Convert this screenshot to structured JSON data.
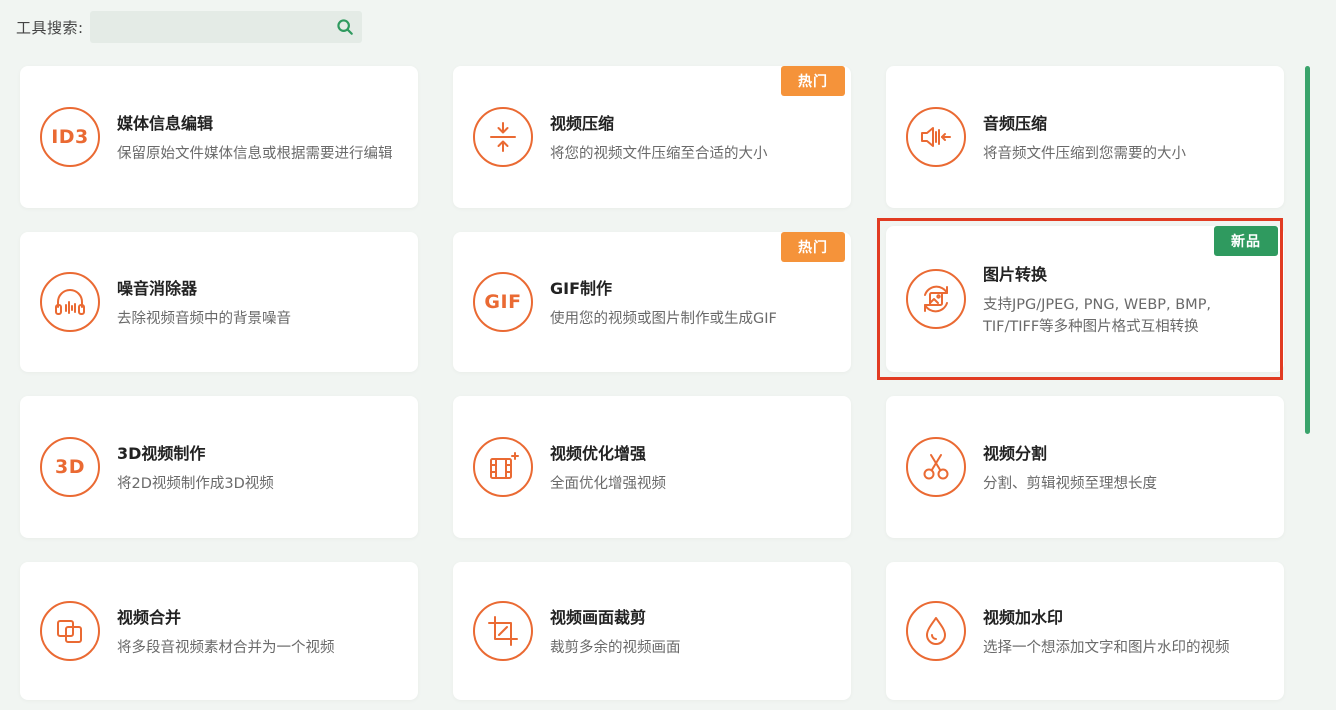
{
  "search": {
    "label": "工具搜索:",
    "value": "",
    "placeholder": ""
  },
  "badges": {
    "hot": "热门",
    "new": "新品"
  },
  "accent": "#ea6a33",
  "tools": [
    {
      "title": "媒体信息编辑",
      "desc": "保留原始文件媒体信息或根据需要进行编辑",
      "icon_text": "ID3",
      "icon": "id3-icon"
    },
    {
      "title": "视频压缩",
      "desc": "将您的视频文件压缩至合适的大小",
      "icon": "compress-icon",
      "badge": "热门"
    },
    {
      "title": "音频压缩",
      "desc": "将音频文件压缩到您需要的大小",
      "icon": "audio-compress-icon"
    },
    {
      "title": "噪音消除器",
      "desc": "去除视频音频中的背景噪音",
      "icon": "headphones-icon"
    },
    {
      "title": "GIF制作",
      "desc": "使用您的视频或图片制作或生成GIF",
      "icon_text": "GIF",
      "icon": "gif-icon",
      "badge": "热门"
    },
    {
      "title": "图片转换",
      "desc": "支持JPG/JPEG, PNG, WEBP, BMP, TIF/TIFF等多种图片格式互相转换",
      "icon": "image-convert-icon",
      "badge": "新品"
    },
    {
      "title": "3D视频制作",
      "desc": "将2D视频制作成3D视频",
      "icon_text": "3D",
      "icon": "3d-icon"
    },
    {
      "title": "视频优化增强",
      "desc": "全面优化增强视频",
      "icon": "film-enhance-icon"
    },
    {
      "title": "视频分割",
      "desc": "分割、剪辑视频至理想长度",
      "icon": "scissors-icon"
    },
    {
      "title": "视频合并",
      "desc": "将多段音视频素材合并为一个视频",
      "icon": "merge-icon"
    },
    {
      "title": "视频画面裁剪",
      "desc": "裁剪多余的视频画面",
      "icon": "crop-icon"
    },
    {
      "title": "视频加水印",
      "desc": "选择一个想添加文字和图片水印的视频",
      "icon": "watermark-icon"
    }
  ]
}
